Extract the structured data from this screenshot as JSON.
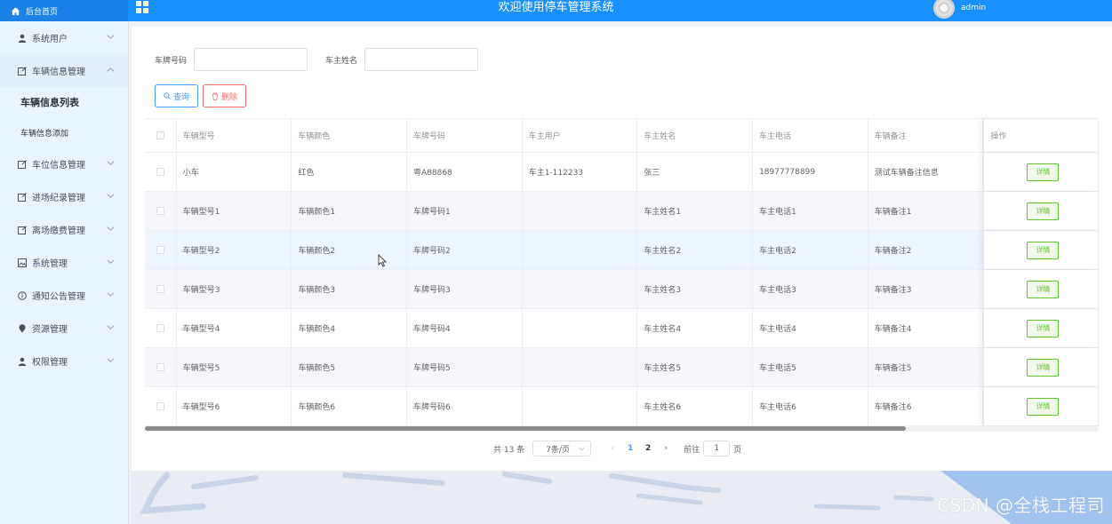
{
  "header": {
    "home_label": "后台首页",
    "title": "欢迎使用停车管理系统",
    "user_name": "admin"
  },
  "sidebar": {
    "items": [
      {
        "label": "系统用户",
        "icon": "user-icon"
      },
      {
        "label": "车辆信息管理",
        "icon": "edit-icon",
        "open": true
      },
      {
        "label": "车位信息管理",
        "icon": "edit-icon"
      },
      {
        "label": "进场纪录管理",
        "icon": "edit-icon"
      },
      {
        "label": "离场缴费管理",
        "icon": "edit-icon"
      },
      {
        "label": "系统管理",
        "icon": "picture-icon"
      },
      {
        "label": "通知公告管理",
        "icon": "info-icon"
      },
      {
        "label": "资源管理",
        "icon": "location-icon"
      },
      {
        "label": "权限管理",
        "icon": "user-icon"
      }
    ],
    "subitems": [
      {
        "label": "车辆信息列表",
        "active": true
      },
      {
        "label": "车辆信息添加"
      }
    ]
  },
  "search": {
    "plate_label": "车牌号码",
    "plate_value": "",
    "owner_label": "车主姓名",
    "owner_value": "",
    "query_button": "查询",
    "delete_button": "删除"
  },
  "table": {
    "columns": [
      "车辆型号",
      "车辆颜色",
      "车牌号码",
      "车主用户",
      "车主姓名",
      "车主电话",
      "车辆备注",
      "操作"
    ],
    "rows": [
      [
        "小车",
        "红色",
        "粤A88868",
        "车主1-112233",
        "张三",
        "18977778899",
        "测试车辆备注信息"
      ],
      [
        "车辆型号1",
        "车辆颜色1",
        "车牌号码1",
        "",
        "车主姓名1",
        "车主电话1",
        "车辆备注1"
      ],
      [
        "车辆型号2",
        "车辆颜色2",
        "车牌号码2",
        "",
        "车主姓名2",
        "车主电话2",
        "车辆备注2"
      ],
      [
        "车辆型号3",
        "车辆颜色3",
        "车牌号码3",
        "",
        "车主姓名3",
        "车主电话3",
        "车辆备注3"
      ],
      [
        "车辆型号4",
        "车辆颜色4",
        "车牌号码4",
        "",
        "车主姓名4",
        "车主电话4",
        "车辆备注4"
      ],
      [
        "车辆型号5",
        "车辆颜色5",
        "车牌号码5",
        "",
        "车主姓名5",
        "车主电话5",
        "车辆备注5"
      ],
      [
        "车辆型号6",
        "车辆颜色6",
        "车牌号码6",
        "",
        "车主姓名6",
        "车主电话6",
        "车辆备注6"
      ]
    ],
    "detail_label": "详情"
  },
  "pagination": {
    "total_text": "共 13 条",
    "page_size": "7条/页",
    "pages": [
      "1",
      "2"
    ],
    "current_page": "1",
    "goto_prefix": "前往",
    "goto_value": "1",
    "goto_suffix": "页"
  },
  "watermark": "CSDN @全栈工程司",
  "colors": {
    "primary": "#1890ff",
    "danger": "#f56c6c",
    "success": "#67c23a",
    "sidebar_bg": "#eaf4ff"
  }
}
